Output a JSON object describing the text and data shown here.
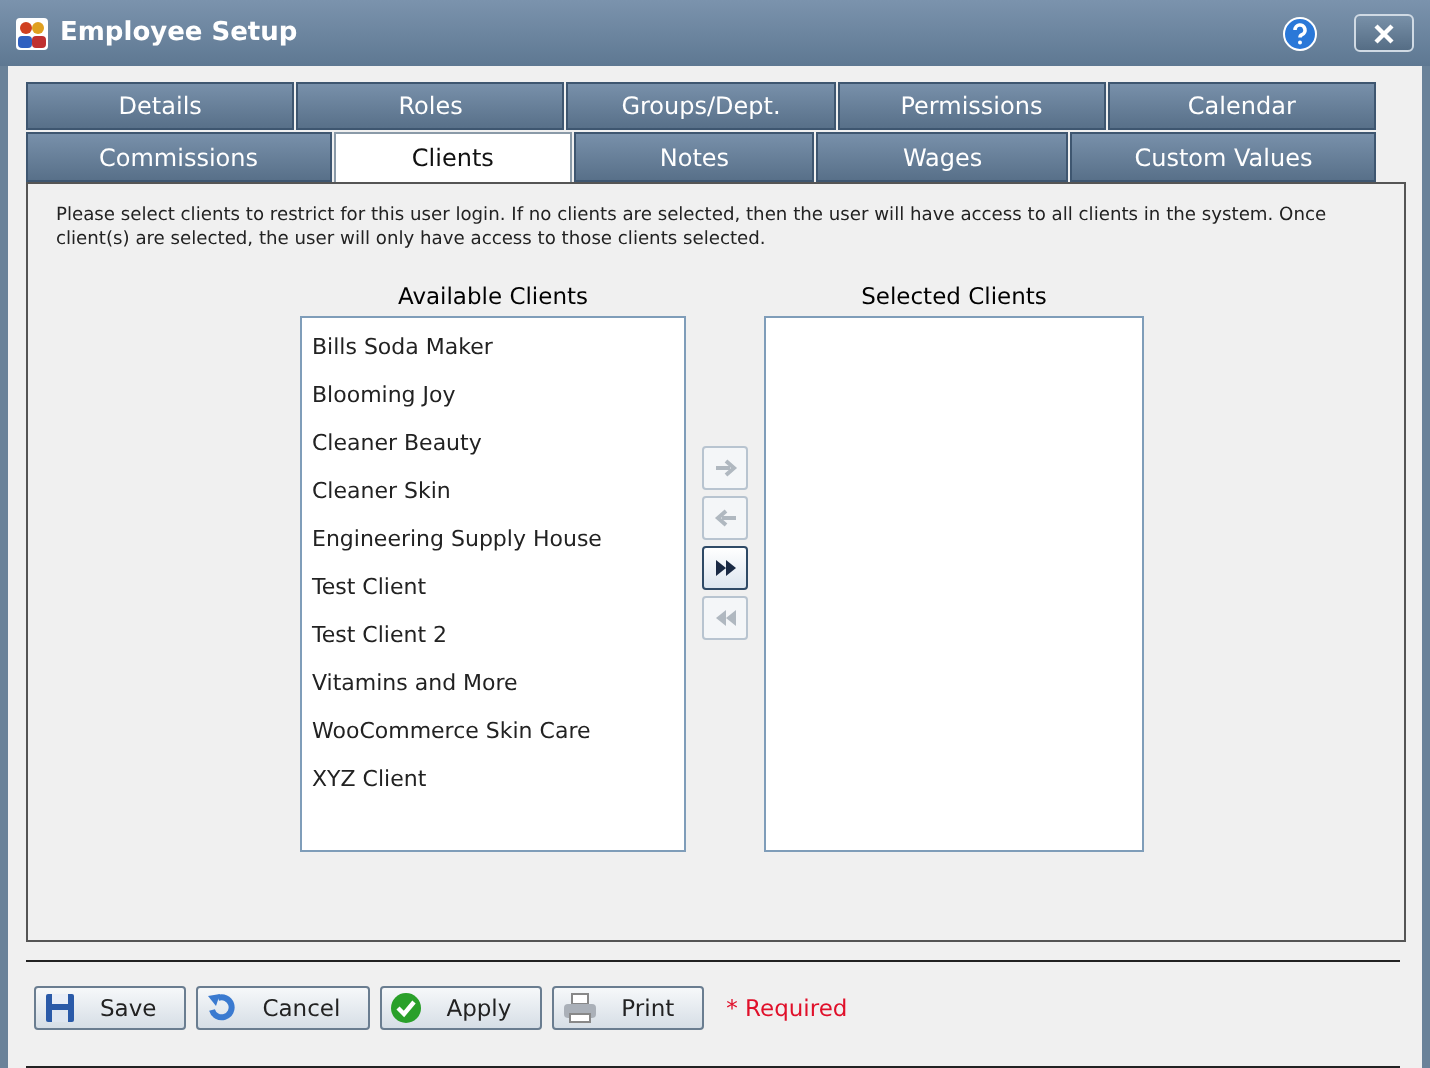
{
  "window": {
    "title": "Employee Setup"
  },
  "tabs": [
    [
      {
        "label": "Details",
        "selected": false
      },
      {
        "label": "Roles",
        "selected": false
      },
      {
        "label": "Groups/Dept.",
        "selected": false
      },
      {
        "label": "Permissions",
        "selected": false
      },
      {
        "label": "Calendar",
        "selected": false
      }
    ],
    [
      {
        "label": "Commissions",
        "selected": false
      },
      {
        "label": "Clients",
        "selected": true
      },
      {
        "label": "Notes",
        "selected": false
      },
      {
        "label": "Wages",
        "selected": false
      },
      {
        "label": "Custom Values",
        "selected": false
      }
    ]
  ],
  "instructions": "Please select clients to restrict for this user login. If no clients are selected, then the user will have access to all clients in the system. Once client(s) are selected, the user will only have access to those clients selected.",
  "available": {
    "title": "Available Clients",
    "items": [
      "Bills Soda Maker",
      "Blooming Joy",
      "Cleaner Beauty",
      "Cleaner Skin",
      "Engineering Supply House",
      "Test Client",
      "Test Client 2",
      "Vitamins and More",
      "WooCommerce Skin Care",
      "XYZ Client"
    ]
  },
  "selected_list": {
    "title": "Selected Clients"
  },
  "move_buttons": [
    {
      "kind": "right",
      "disabled": true
    },
    {
      "kind": "left",
      "disabled": true
    },
    {
      "kind": "all-right",
      "disabled": false
    },
    {
      "kind": "all-left",
      "disabled": true
    }
  ],
  "footer_buttons": [
    {
      "kind": "save",
      "label": "Save"
    },
    {
      "kind": "cancel",
      "label": "Cancel"
    },
    {
      "kind": "apply",
      "label": "Apply"
    },
    {
      "kind": "print",
      "label": "Print"
    }
  ],
  "required_note": "* Required"
}
